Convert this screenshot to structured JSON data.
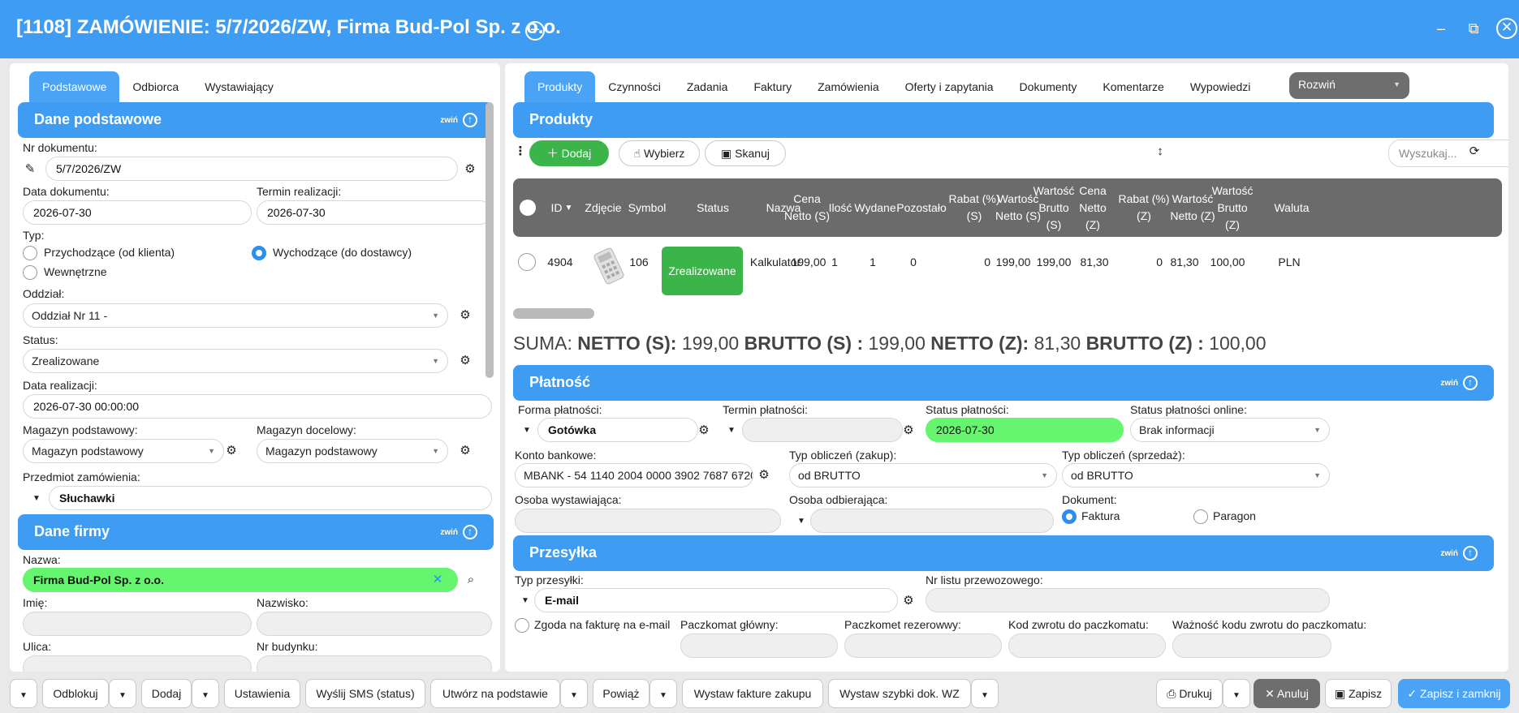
{
  "window": {
    "title": "[1108] ZAMÓWIENIE: 5/7/2026/ZW, Firma Bud-Pol Sp. z o.o.",
    "plus": "+",
    "minimize": "‒",
    "restore": "⧉",
    "close": "✕"
  },
  "left": {
    "tabs": [
      "Podstawowe",
      "Odbiorca",
      "Wystawiający"
    ],
    "collapse_label": "zwiń",
    "section_basic": "Dane podstawowe",
    "doc_number_label": "Nr dokumentu:",
    "doc_number": "5/7/2026/ZW",
    "doc_date_label": "Data dokumentu:",
    "doc_date": "2026-07-30",
    "due_label": "Termin realizacji:",
    "due_date": "2026-07-30",
    "type_label": "Typ:",
    "type_incoming": "Przychodzące (od klienta)",
    "type_outgoing": "Wychodzące (do dostawcy)",
    "type_internal": "Wewnętrzne",
    "branch_label": "Oddział:",
    "branch": "Oddział Nr 11 -",
    "status_label": "Status:",
    "status": "Zrealizowane",
    "realization_date_label": "Data realizacji:",
    "realization_date": "2026-07-30 00:00:00",
    "main_wh_label": "Magazyn podstawowy:",
    "main_wh": "Magazyn podstawowy",
    "target_wh_label": "Magazyn docelowy:",
    "target_wh": "Magazyn podstawowy",
    "subject_label": "Przedmiot zamówienia:",
    "subject": "Słuchawki",
    "section_company": "Dane firmy",
    "name_label": "Nazwa:",
    "name": "Firma Bud-Pol Sp. z o.o.",
    "first_name_label": "Imię:",
    "last_name_label": "Nazwisko:",
    "street_label": "Ulica:",
    "building_label": "Nr budynku:"
  },
  "right": {
    "tabs": [
      "Produkty",
      "Czynności",
      "Zadania",
      "Faktury",
      "Zamówienia",
      "Oferty i zapytania",
      "Dokumenty",
      "Komentarze",
      "Wypowiedzi"
    ],
    "expand_select": "Rozwiń",
    "section_products": "Produkty",
    "collapse_label": "zwiń",
    "add_btn": "Dodaj",
    "choose_btn": "Wybierz",
    "scan_btn": "Skanuj",
    "search_placeholder": "Wyszukaj...",
    "columns": [
      "ID",
      "Zdjęcie",
      "Symbol",
      "Status",
      "Nazwa",
      "Cena Netto (S)",
      "Ilość",
      "Wydane",
      "Pozostało",
      "Rabat (%) (S)",
      "Wartość Netto (S)",
      "Wartość Brutto (S)",
      "Cena Netto (Z)",
      "Rabat (%) (Z)",
      "Wartość Netto (Z)",
      "Wartość Brutto (Z)",
      "Waluta"
    ],
    "row": {
      "id": "4904",
      "symbol": "106",
      "status": "Zrealizowane",
      "name": "Kalkulator",
      "price_net_s": "199,00",
      "qty": "1",
      "issued": "1",
      "remaining": "0",
      "discount_s": "0",
      "value_net_s": "199,00",
      "value_gross_s": "199,00",
      "price_net_z": "81,30",
      "discount_z": "0",
      "value_net_z": "81,30",
      "value_gross_z": "100,00",
      "currency": "PLN"
    },
    "sum": {
      "prefix": "SUMA:",
      "net_s_label": "NETTO (S):",
      "net_s": "199,00",
      "gross_s_label": "BRUTTO (S) :",
      "gross_s": "199,00",
      "net_z_label": "NETTO (Z):",
      "net_z": "81,30",
      "gross_z_label": "BRUTTO (Z) :",
      "gross_z": "100,00"
    },
    "section_payment": "Płatność",
    "pay_form_label": "Forma płatności:",
    "pay_form": "Gotówka",
    "pay_due_label": "Termin płatności:",
    "pay_status_label": "Status płatności:",
    "pay_status": "2026-07-30",
    "pay_online_label": "Status płatności online:",
    "pay_online": "Brak informacji",
    "bank_label": "Konto bankowe:",
    "bank": "MBANK - 54 1140 2004 0000 3902 7687 6720",
    "calc_buy_label": "Typ obliczeń (zakup):",
    "calc_buy": "od BRUTTO",
    "calc_sell_label": "Typ obliczeń (sprzedaż):",
    "calc_sell": "od BRUTTO",
    "issuer_label": "Osoba wystawiająca:",
    "receiver_label": "Osoba odbierająca:",
    "document_label": "Dokument:",
    "doc_invoice": "Faktura",
    "doc_receipt": "Paragon",
    "section_shipping": "Przesyłka",
    "ship_type_label": "Typ przesyłki:",
    "ship_type": "E-mail",
    "waybill_label": "Nr listu przewozowego:",
    "consent": "Zgoda na fakturę na e-mail",
    "locker_main_label": "Paczkomat główny:",
    "locker_backup_label": "Paczkomet rezerowwy:",
    "return_code_label": "Kod zwrotu do paczkomatu:",
    "return_validity_label": "Ważność kodu zwrotu do paczkomatu:"
  },
  "bottom": {
    "unlock": "Odblokuj",
    "add": "Dodaj",
    "settings": "Ustawienia",
    "sms": "Wyślij SMS (status)",
    "create_from": "Utwórz na podstawie",
    "link": "Powiąż",
    "purchase_invoice": "Wystaw fakture zakupu",
    "quick_wz": "Wystaw szybki dok. WZ",
    "print": "Drukuj",
    "cancel": "Anuluj",
    "save": "Zapisz",
    "save_close": "Zapisz i zamknij"
  }
}
